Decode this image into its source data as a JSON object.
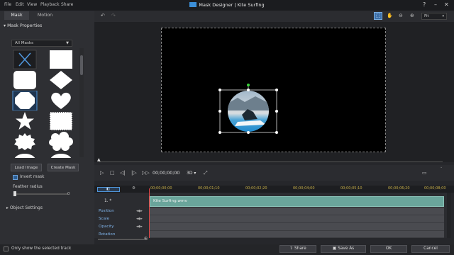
{
  "menu": [
    "File",
    "Edit",
    "View",
    "Playback",
    "Share"
  ],
  "title": "Mask Designer | Kite Surfing",
  "window_controls": {
    "help": "?",
    "minimize": "–",
    "maximize": "□",
    "close": "✕"
  },
  "tabs": [
    "Mask",
    "Motion"
  ],
  "mask_properties": "Mask Properties",
  "all_masks": "All Masks",
  "load_image": "Load Image",
  "create_mask": "Create Mask",
  "invert_mask": "Invert mask",
  "feather_radius": "Feather radius",
  "feather_value": "0",
  "object_settings": "Object Settings",
  "zoom": "Fit",
  "timecode": "00;00;00;00",
  "mode3d": "3D",
  "ruler": [
    "00;00;00;00",
    "00;00;01;10",
    "00;00;02;20",
    "00;00;04;00",
    "00;00;05;10",
    "00;00;06;20",
    "00;00;08;00"
  ],
  "track_name": "1. *",
  "clip": "Kite Surfing.wmv",
  "props": [
    "Position",
    "Scale",
    "Opacity",
    "Rotation"
  ],
  "only_selected": "Only show the selected track",
  "share": "Share",
  "save_as": "Save As",
  "ok": "OK",
  "cancel": "Cancel",
  "colors": {
    "accent": "#3c8fd8",
    "clip": "#6aa59b",
    "ruler": "#c9b04a",
    "playhead": "#e04545"
  }
}
